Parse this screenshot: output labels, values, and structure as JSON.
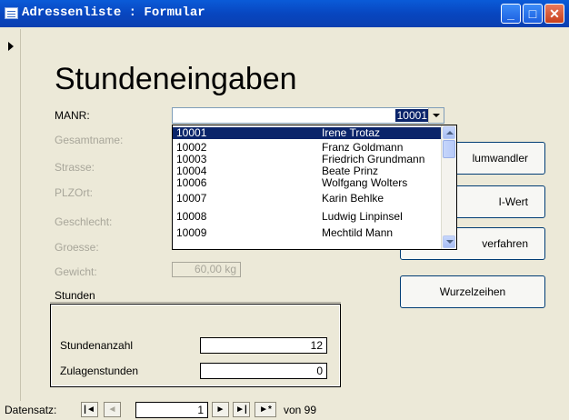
{
  "window": {
    "title": "Adressenliste : Formular",
    "minimize_label": "_",
    "maximize_label": "□",
    "close_label": "✕"
  },
  "form": {
    "heading": "Stundeneingaben",
    "manr_label": "MANR:",
    "manr_value": "10001",
    "fields": {
      "gesamtname": "Gesamtname:",
      "strasse": "Strasse:",
      "plzort": "PLZOrt:",
      "geschlecht": "Geschlecht:",
      "groesse": "Groesse:",
      "gewicht": "Gewicht:",
      "gewicht_value": "60,00 kg"
    },
    "dropdown": [
      {
        "id": "10001",
        "name": "Irene Trotaz",
        "selected": true
      },
      {
        "id": "10002",
        "name": "Franz Goldmann"
      },
      {
        "id": "10003",
        "name": "Friedrich Grundmann"
      },
      {
        "id": "10004",
        "name": "Beate Prinz"
      },
      {
        "id": "10006",
        "name": "Wolfgang Wolters"
      },
      {
        "id": "10007",
        "name": "Karin Behlke"
      },
      {
        "id": "10008",
        "name": "Ludwig Linpinsel"
      },
      {
        "id": "10009",
        "name": "Mechtild Mann"
      }
    ],
    "buttons": {
      "volumwandler": "lumwandler",
      "iwert": "I-Wert",
      "verfahren": "verfahren",
      "wurzelzeihen": "Wurzelzeihen"
    },
    "stunden_section": "Stunden",
    "stundenanzahl_label": "Stundenanzahl",
    "stundenanzahl_value": "12",
    "zulagenstunden_label": "Zulagenstunden",
    "zulagenstunden_value": "0"
  },
  "navigation": {
    "label": "Datensatz:",
    "first": "|◄",
    "prev": "◄",
    "current": "1",
    "next": "►",
    "last": "►|",
    "new": "►*",
    "total": "von 99"
  }
}
